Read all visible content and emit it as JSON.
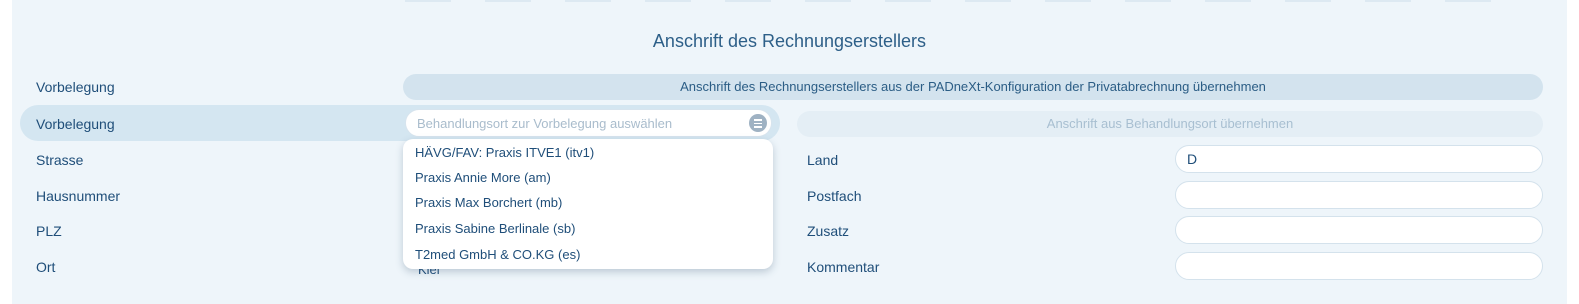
{
  "section_title": "Anschrift des Rechnungserstellers",
  "rows": {
    "vorbelegung_1": "Vorbelegung",
    "vorbelegung_2": "Vorbelegung",
    "strasse": "Strasse",
    "hausnummer": "Hausnummer",
    "plz": "PLZ",
    "ort": "Ort"
  },
  "padnext_button": "Anschrift des Rechnungserstellers aus der PADneXt-Konfiguration der Privatabrechnung übernehmen",
  "behandlungsort_select": {
    "placeholder": "Behandlungsort zur Vorbelegung auswählen",
    "options": [
      "HÄVG/FAV: Praxis ITVE1 (itv1)",
      "Praxis Annie More (am)",
      "Praxis Max Borchert (mb)",
      "Praxis Sabine Berlinale (sb)",
      "T2med GmbH & CO.KG (es)"
    ]
  },
  "behandlungsort_button": "Anschrift aus Behandlungsort übernehmen",
  "right_fields": {
    "land_label": "Land",
    "land_value": "D",
    "postfach_label": "Postfach",
    "postfach_value": "",
    "zusatz_label": "Zusatz",
    "zusatz_value": "",
    "kommentar_label": "Kommentar",
    "kommentar_value": ""
  },
  "ort_value_partial": "Kiel",
  "colors": {
    "panel_bg": "#eef5fa",
    "accent_text": "#1f4e79",
    "button_bg": "#d3e3ee"
  }
}
